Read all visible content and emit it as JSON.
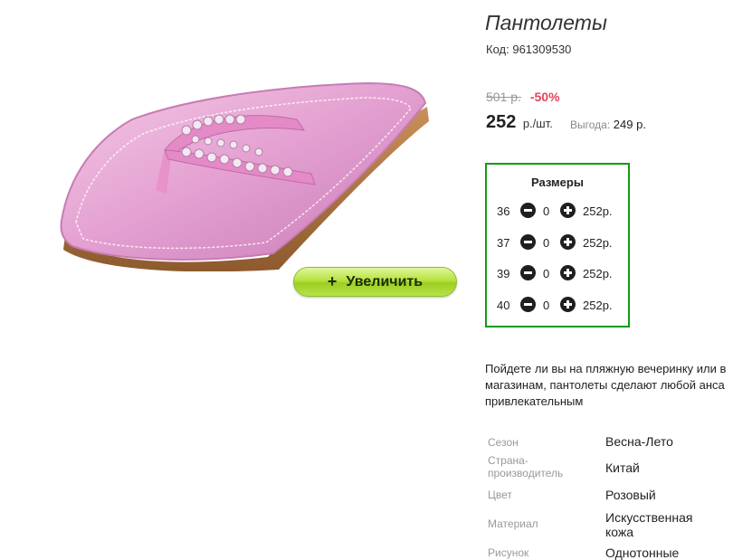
{
  "product": {
    "title": "Пантолеты",
    "code_label": "Код:",
    "code_value": "961309530",
    "old_price": "501 р.",
    "discount": "-50%",
    "price": "252",
    "price_unit": "р./шт.",
    "benefit_label": "Выгода:",
    "benefit_value": "249 р."
  },
  "image": {
    "alt": "Пантолеты розовые с бусинами",
    "zoom_label": "Увеличить",
    "zoom_icon": "+"
  },
  "sizes": {
    "title": "Размеры",
    "rows": [
      {
        "size": "36",
        "qty": "0",
        "price": "252р."
      },
      {
        "size": "37",
        "qty": "0",
        "price": "252р."
      },
      {
        "size": "39",
        "qty": "0",
        "price": "252р."
      },
      {
        "size": "40",
        "qty": "0",
        "price": "252р."
      }
    ]
  },
  "description": {
    "lines": [
      "Пойдете ли вы на пляжную вечеринку или в ",
      "магазинам, пантолеты сделают любой анса",
      "привлекательным"
    ]
  },
  "specs": [
    {
      "label_lines": [
        "Сезон"
      ],
      "value_lines": [
        "Весна-Лето"
      ]
    },
    {
      "label_lines": [
        "Страна-",
        "производитель"
      ],
      "value_lines": [
        "Китай"
      ]
    },
    {
      "label_lines": [
        "Цвет"
      ],
      "value_lines": [
        "Розовый"
      ]
    },
    {
      "label_lines": [
        "Материал"
      ],
      "value_lines": [
        "Искусственная",
        "кожа"
      ]
    },
    {
      "label_lines": [
        "Рисунок"
      ],
      "value_lines": [
        "Однотонные"
      ]
    }
  ],
  "colors": {
    "accent_green": "#139b13",
    "discount_red": "#e0455f",
    "button_green": "#b7e23f",
    "sandal_pink": "#e6a6d4"
  }
}
